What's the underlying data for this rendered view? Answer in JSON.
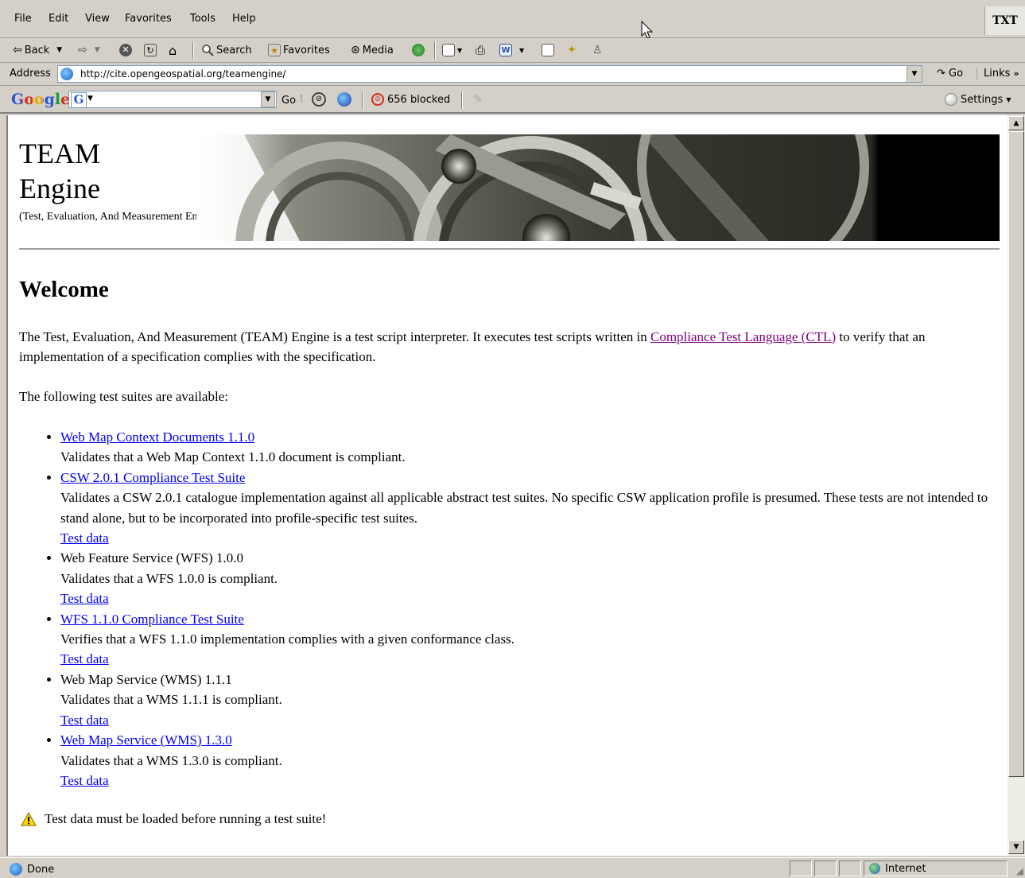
{
  "menu": {
    "items": [
      "File",
      "Edit",
      "View",
      "Favorites",
      "Tools",
      "Help"
    ],
    "brand": "TXT"
  },
  "toolbar": {
    "back_label": "Back",
    "search_label": "Search",
    "favorites_label": "Favorites",
    "media_label": "Media"
  },
  "address": {
    "label": "Address",
    "url": "http://cite.opengeospatial.org/teamengine/",
    "go_label": "Go",
    "links_label": "Links"
  },
  "google": {
    "logo": "Google",
    "go_label": "Go",
    "blocked_label": "656 blocked",
    "settings_label": "Settings"
  },
  "page": {
    "title_line1": "TEAM",
    "title_line2": "Engine",
    "subtitle": "(Test, Evaluation, And Measurement Engine)",
    "heading": "Welcome",
    "intro_before": "The Test, Evaluation, And Measurement (TEAM) Engine is a test script interpreter. It executes test scripts written in ",
    "intro_link": "Compliance Test Language (CTL)",
    "intro_after": " to verify that an implementation of a specification complies with the specification.",
    "available": "The following test suites are available:",
    "suites": [
      {
        "name": "Web Map Context Documents 1.1.0",
        "linked": true,
        "desc": "Validates that a Web Map Context 1.1.0 document is compliant.",
        "test_data": ""
      },
      {
        "name": "CSW 2.0.1 Compliance Test Suite",
        "linked": true,
        "desc": "Validates a CSW 2.0.1 catalogue implementation against all applicable abstract test suites. No specific CSW application profile is presumed. These tests are not intended to stand alone, but to be incorporated into profile-specific test suites.",
        "test_data": "Test data"
      },
      {
        "name": "Web Feature Service (WFS) 1.0.0",
        "linked": false,
        "desc": "Validates that a WFS 1.0.0 is compliant.",
        "test_data": "Test data"
      },
      {
        "name": "WFS 1.1.0 Compliance Test Suite",
        "linked": true,
        "desc": "Verifies that a WFS 1.1.0 implementation complies with a given conformance class.",
        "test_data": "Test data"
      },
      {
        "name": "Web Map Service (WMS) 1.1.1",
        "linked": false,
        "desc": "Validates that a WMS 1.1.1 is compliant.",
        "test_data": "Test data"
      },
      {
        "name": "Web Map Service (WMS) 1.3.0",
        "linked": true,
        "desc": "Validates that a WMS 1.3.0 is compliant.",
        "test_data": "Test data"
      }
    ],
    "warning": "Test data must be loaded before running a test suite!"
  },
  "status": {
    "left": "Done",
    "zone": "Internet"
  },
  "colors": {
    "chrome": "#d4d0c8",
    "link": "#0000ee",
    "visited": "#800080"
  }
}
